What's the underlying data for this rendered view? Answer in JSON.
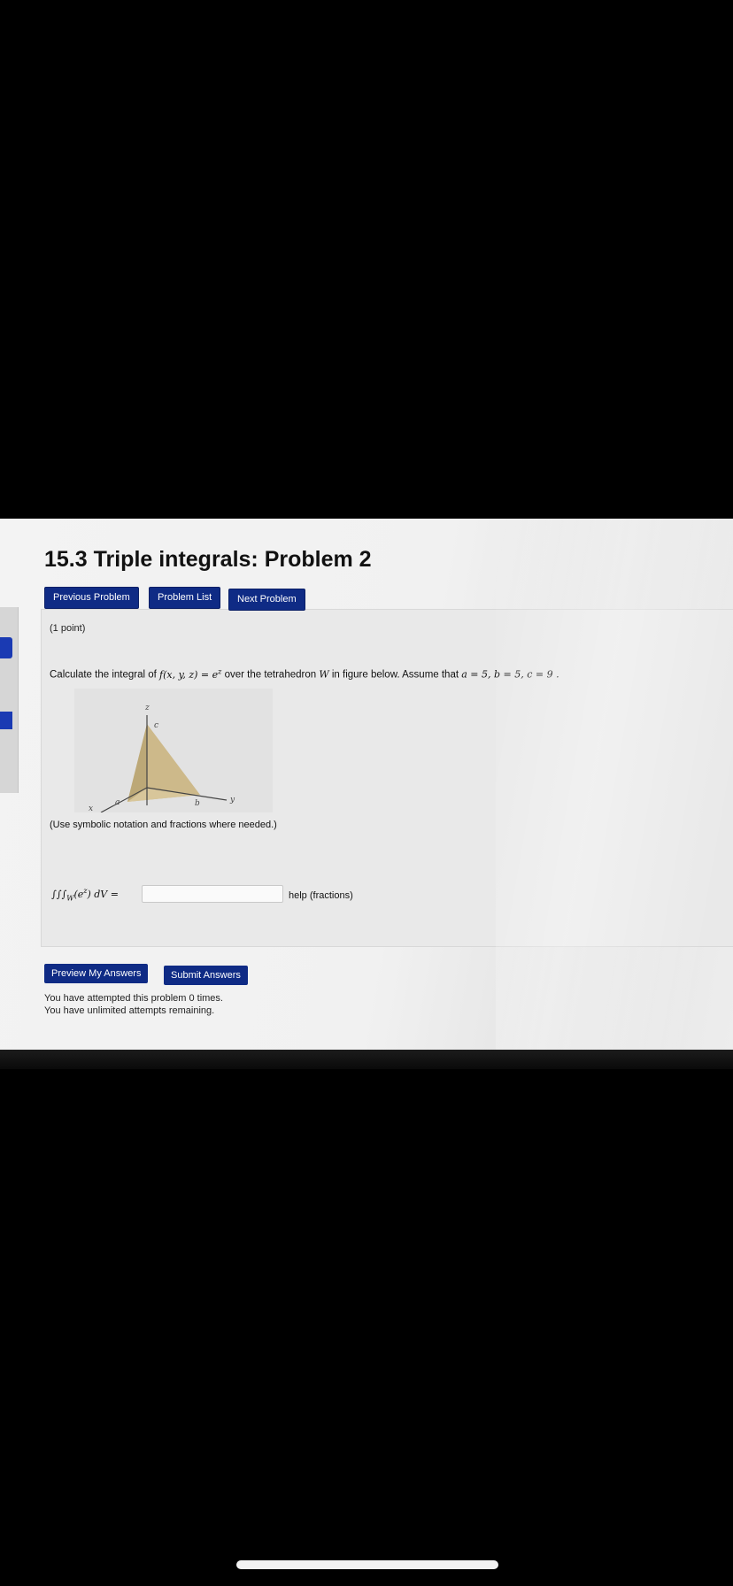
{
  "page": {
    "title": "15.3 Triple integrals: Problem 2"
  },
  "nav": {
    "previous_label": "Previous Problem",
    "list_label": "Problem List",
    "next_label": "Next Problem"
  },
  "problem": {
    "points": "(1 point)",
    "statement_prefix": "Calculate the integral of ",
    "function_expr": "f(x, y, z) = e",
    "function_exp": "z",
    "statement_middle": " over the tetrahedron ",
    "region": "W",
    "statement_suffix": " in figure below. Assume that ",
    "assumptions": "a = 5,  b = 5,  c = 9 .",
    "hint": "(Use symbolic notation and fractions where needed.)"
  },
  "figure": {
    "axis_z": "z",
    "axis_y": "y",
    "axis_x": "x",
    "label_a": "a",
    "label_b": "b",
    "label_c": "c"
  },
  "answer": {
    "integral_prefix": "∫∫∫",
    "integral_sub": "W",
    "integrand": "(e",
    "integrand_exp": "z",
    "integral_suffix": ") dV =",
    "value": "",
    "help_label": "help (fractions)"
  },
  "actions": {
    "preview_label": "Preview My Answers",
    "submit_label": "Submit Answers"
  },
  "status": {
    "attempted": "You have attempted this problem 0 times.",
    "remaining": "You have unlimited attempts remaining."
  }
}
